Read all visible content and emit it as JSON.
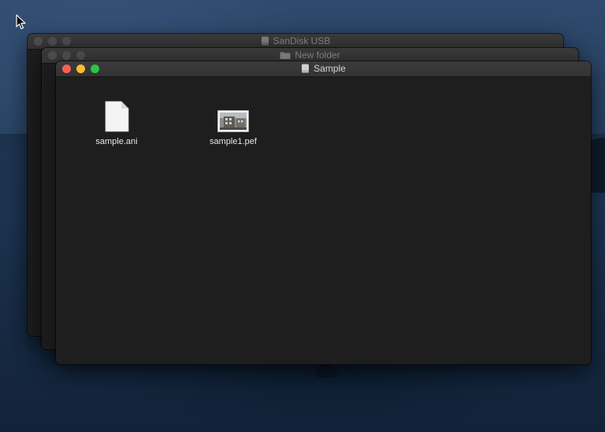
{
  "desktop": {
    "wallpaper": "macOS Catalina dark island wallpaper",
    "colors": {
      "active_close": "#fd5f57",
      "active_minimize": "#fdbc2e",
      "active_zoom": "#28c840",
      "inactive_button": "#4d4d4d",
      "window_background": "#1e1e1e"
    }
  },
  "windows": [
    {
      "title": "SanDisk USB",
      "title_icon": "drive-icon",
      "active": false
    },
    {
      "title": "New folder",
      "title_icon": "folder-icon",
      "active": false
    },
    {
      "title": "Sample",
      "title_icon": "drive-icon",
      "active": true,
      "items": [
        {
          "name": "sample.ani",
          "icon": "blank-document-icon"
        },
        {
          "name": "sample1.pef",
          "icon": "image-thumbnail-icon"
        }
      ]
    }
  ]
}
